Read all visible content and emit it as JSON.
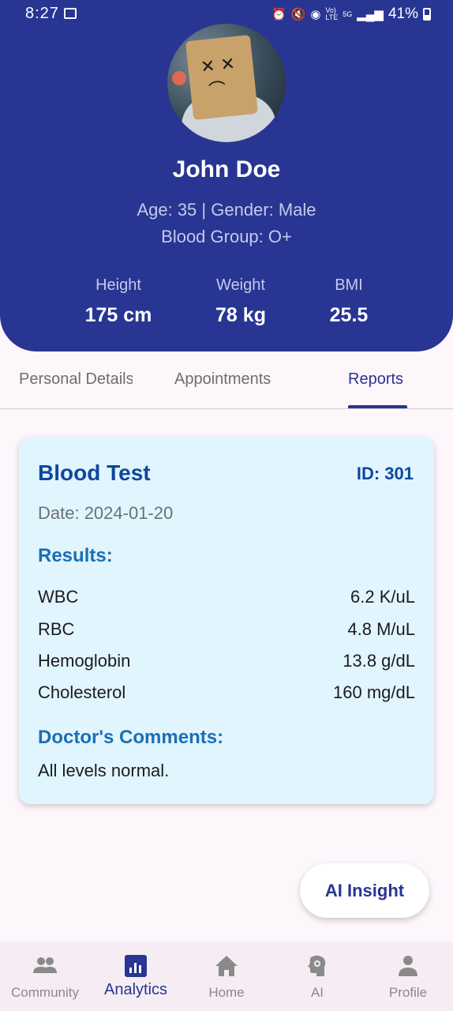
{
  "status_bar": {
    "time": "8:27",
    "icons": [
      "alarm-icon",
      "mute-icon",
      "hotspot-icon",
      "volte-icon",
      "5g-icon",
      "signal-icon"
    ],
    "battery": "41%"
  },
  "profile": {
    "name": "John Doe",
    "age_gender": "Age: 35 | Gender: Male",
    "blood_group": "Blood Group: O+",
    "stats": [
      {
        "label": "Height",
        "value": "175 cm"
      },
      {
        "label": "Weight",
        "value": "78 kg"
      },
      {
        "label": "BMI",
        "value": "25.5"
      }
    ]
  },
  "tabs": [
    {
      "label": "Personal Details",
      "active": false
    },
    {
      "label": "Appointments",
      "active": false
    },
    {
      "label": "Reports",
      "active": true
    }
  ],
  "report": {
    "title": "Blood Test",
    "id": "ID: 301",
    "date": "Date: 2024-01-20",
    "results_title": "Results:",
    "results": [
      {
        "name": "WBC",
        "value": "6.2 K/uL"
      },
      {
        "name": "RBC",
        "value": "4.8 M/uL"
      },
      {
        "name": "Hemoglobin",
        "value": "13.8 g/dL"
      },
      {
        "name": "Cholesterol",
        "value": "160 mg/dL"
      }
    ],
    "comments_title": "Doctor's Comments:",
    "comments": "All levels normal."
  },
  "fab": {
    "label": "AI Insight"
  },
  "nav": [
    {
      "label": "Community",
      "icon": "community-icon",
      "active": false
    },
    {
      "label": "Analytics",
      "icon": "analytics-icon",
      "active": true
    },
    {
      "label": "Home",
      "icon": "home-icon",
      "active": false
    },
    {
      "label": "AI",
      "icon": "ai-brain-icon",
      "active": false
    },
    {
      "label": "Profile",
      "icon": "profile-icon",
      "active": false
    }
  ],
  "colors": {
    "primary": "#283593",
    "card_bg": "#e1f5fe",
    "accent_blue": "#0d47a1",
    "background": "#fdf6fb"
  }
}
